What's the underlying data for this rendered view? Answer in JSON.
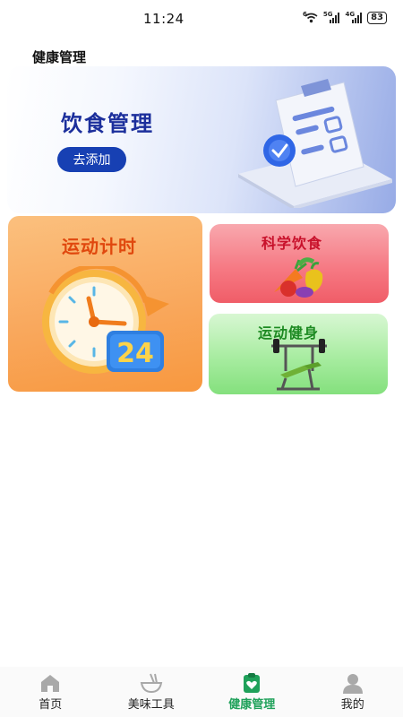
{
  "status_bar": {
    "time": "11:24",
    "network_wifi": "6",
    "network_5g": "5G",
    "network_4g": "4G",
    "battery": "83"
  },
  "page": {
    "title": "健康管理"
  },
  "banner": {
    "title": "饮食管理",
    "button_label": "去添加"
  },
  "cards": {
    "timer": {
      "label": "运动计时",
      "badge": "24",
      "icon": "alarm-clock-icon"
    },
    "diet": {
      "label": "科学饮食",
      "icon": "vegetables-icon"
    },
    "fitness": {
      "label": "运动健身",
      "icon": "weight-bench-icon"
    }
  },
  "tabs": [
    {
      "label": "首页",
      "icon": "home-icon"
    },
    {
      "label": "美味工具",
      "icon": "bowl-icon"
    },
    {
      "label": "健康管理",
      "icon": "health-clipboard-icon",
      "active": true
    },
    {
      "label": "我的",
      "icon": "user-icon"
    }
  ],
  "colors": {
    "accent": "#1fa15a",
    "banner_button": "#1740b3",
    "banner_title": "#1c2f9c",
    "timer_label": "#e0480e",
    "diet_label": "#c8112b",
    "fitness_label": "#1d8a22"
  }
}
